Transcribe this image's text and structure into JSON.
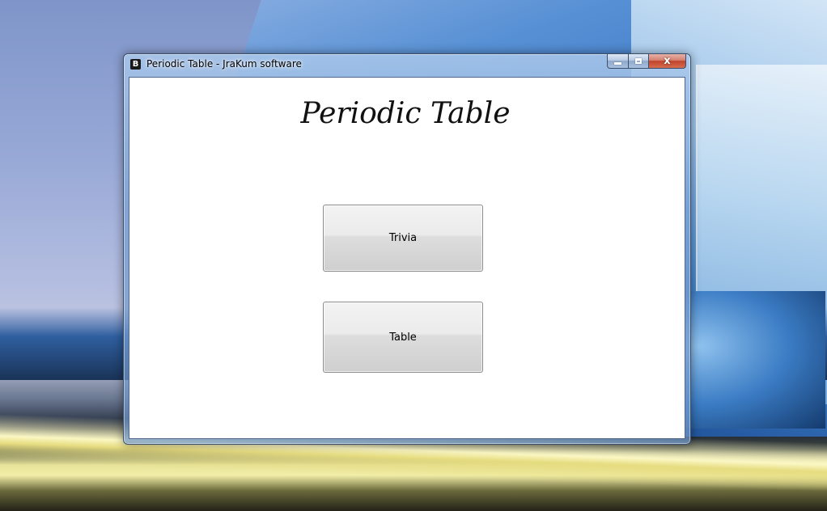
{
  "window": {
    "title": "Periodic Table - JraKum software",
    "app_icon_glyph": "B",
    "close_glyph": "x"
  },
  "main": {
    "heading": "Periodic Table",
    "trivia_button_label": "Trivia",
    "table_button_label": "Table"
  },
  "icons": {
    "app": "app-icon",
    "minimize": "minimize-icon",
    "maximize": "maximize-icon",
    "close": "close-icon"
  },
  "colors": {
    "client_background": "#ffffff",
    "heading_text": "#111111",
    "close_button": "#c0432b"
  }
}
